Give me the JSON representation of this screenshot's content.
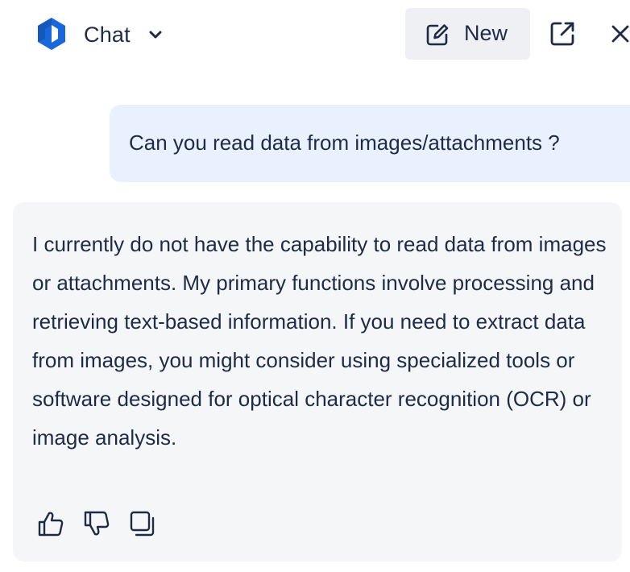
{
  "header": {
    "app_title": "Chat",
    "new_label": "New",
    "logo": "app-logo-icon",
    "brand_color": "#1868db"
  },
  "conversation": {
    "user_message": "Can you read data from images/attachments ?",
    "assistant_message": "I currently do not have the capability to read data from images or attachments. My primary functions involve processing and retrieving text-based information. If you need to extract data from images, you might consider using specialized tools or software designed for optical character recognition (OCR) or image analysis."
  },
  "actions": [
    "thumbs-up-icon",
    "thumbs-down-icon",
    "copy-icon"
  ],
  "colors": {
    "user_bubble": "#e8f1fd",
    "assistant_bubble": "#f5f6f8",
    "text": "#1f2b46"
  }
}
